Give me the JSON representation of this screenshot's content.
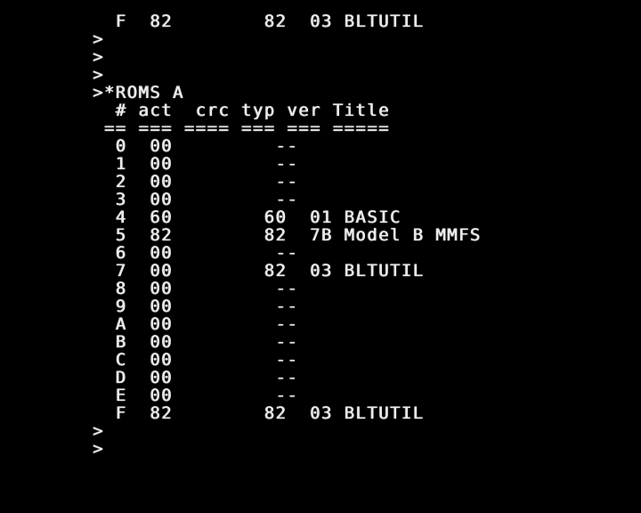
{
  "terminal": {
    "lines": [
      "  F  82        82  03 BLTUTIL",
      ">",
      ">",
      ">",
      ">*ROMS A",
      "  # act  crc typ ver Title",
      " == === ==== === === =====",
      "  0  00         --",
      "  1  00         --",
      "  2  00         --",
      "  3  00         --",
      "  4  60        60  01 BASIC",
      "  5  82        82  7B Model B MMFS",
      "  6  00         --",
      "  7  00        82  03 BLTUTIL",
      "  8  00         --",
      "  9  00         --",
      "  A  00         --",
      "  B  00         --",
      "  C  00         --",
      "  D  00         --",
      "  E  00         --",
      "  F  82        82  03 BLTUTIL",
      ">",
      ">"
    ]
  },
  "colors": {
    "background": "#000000",
    "text": "#ececec"
  }
}
